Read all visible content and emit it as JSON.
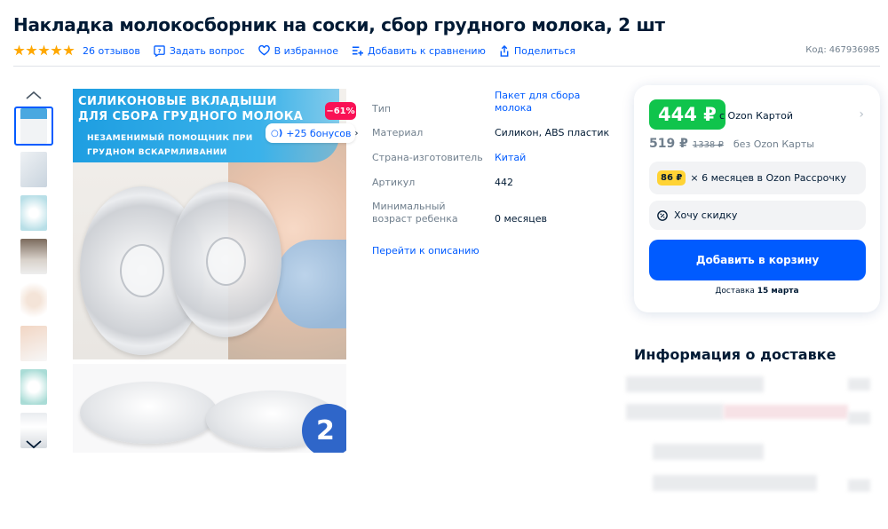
{
  "product": {
    "title": "Накладка молокосборник на соски, сбор грудного молока, 2 шт",
    "code_label": "Код:",
    "code": "467936985"
  },
  "actions": {
    "rating": 5,
    "reviews": "26 отзывов",
    "ask_question": "Задать вопрос",
    "favorites": "В избранное",
    "compare": "Добавить к сравнению",
    "share": "Поделиться"
  },
  "gallery": {
    "thumbnails": 8,
    "active_index": 0,
    "banner_line1": "СИЛИКОНОВЫЕ ВКЛАДЫШИ",
    "banner_line2": "ДЛЯ СБОРА ГРУДНОГО МОЛОКА",
    "banner_sub1": "НЕЗАМЕНИМЫЙ ПОМОЩНИК ПРИ",
    "banner_sub2": "ГРУДНОМ ВСКАРМЛИВАНИИ",
    "count_badge": "2",
    "discount": "−61%",
    "bonus_icon": "○)",
    "bonus": "+25 бонусов"
  },
  "specs": [
    {
      "label": "Тип",
      "value": "Пакет для сбора молока",
      "link": true
    },
    {
      "label": "Материал",
      "value": "Силикон, ABS пластик",
      "link": false
    },
    {
      "label": "Страна-изготовитель",
      "value": "Китай",
      "link": true
    },
    {
      "label": "Артикул",
      "value": "442",
      "link": false
    },
    {
      "label": "Минимальный возраст ребенка",
      "value": "0 месяцев",
      "link": false
    }
  ],
  "goto_description": "Перейти к описанию",
  "price": {
    "card_price": "444 ₽",
    "with_card": "с Ozon Картой",
    "regular_price": "519 ₽",
    "old_price": "1338 ₽",
    "without_card": "без Ozon Карты",
    "installment_amount": "86 ₽",
    "installment_text": "× 6 месяцев в Ozon Рассрочку",
    "want_discount": "Хочу скидку",
    "add_to_cart": "Добавить в корзину",
    "delivery_prefix": "Доставка",
    "delivery_date": "15 марта"
  },
  "delivery": {
    "title": "Информация о доставке"
  },
  "colors": {
    "accent": "#005bff",
    "price_green": "#10c44c",
    "discount_red": "#f91155",
    "installment_yellow": "#ffd335",
    "star": "#ffa800"
  }
}
